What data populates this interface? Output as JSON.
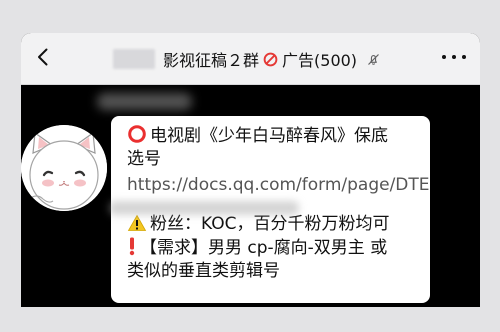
{
  "navbar": {
    "title_prefix": "影视征稿２群",
    "title_suffix": "广告(500)",
    "icons": {
      "back": "chevron-left-icon",
      "ban": "prohibited-icon",
      "mute": "bell-slash-icon",
      "more": "more-dots-icon"
    }
  },
  "message": {
    "line1": "电视剧《少年白马醉春风》保底",
    "line2": "选号",
    "link": "https://docs.qq.com/form/page/DTE",
    "line3": "粉丝：KOC，百分千粉万粉均可",
    "line4": "【需求】男男 cp-腐向-双男主 或",
    "line5": "类似的垂直类剪辑号"
  },
  "colors": {
    "nav_bg": "#f2f2f3",
    "chat_bg": "#000000",
    "bubble_bg": "#ffffff",
    "accent_red": "#e53935",
    "link_text": "#555555",
    "warning_yellow": "#f3c623"
  }
}
